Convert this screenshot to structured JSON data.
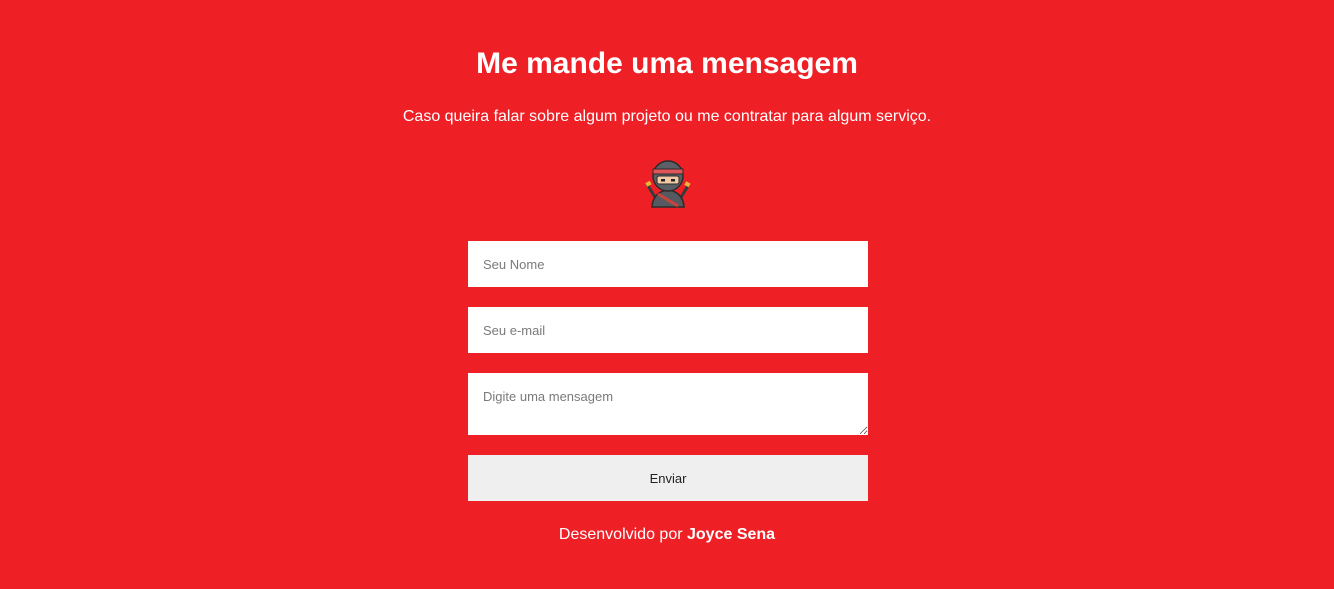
{
  "contact": {
    "title": "Me mande uma mensagem",
    "subtitle": "Caso queira falar sobre algum projeto ou me contratar para algum serviço.",
    "mascot_icon": "ninja-icon",
    "form": {
      "name_placeholder": "Seu Nome",
      "email_placeholder": "Seu e-mail",
      "message_placeholder": "Digite uma mensagem",
      "submit_label": "Enviar"
    }
  },
  "footer": {
    "prefix": "Desenvolvido por ",
    "author": "Joyce Sena"
  },
  "colors": {
    "background": "#ef1f26",
    "text": "#ffffff",
    "button": "#efefef"
  }
}
